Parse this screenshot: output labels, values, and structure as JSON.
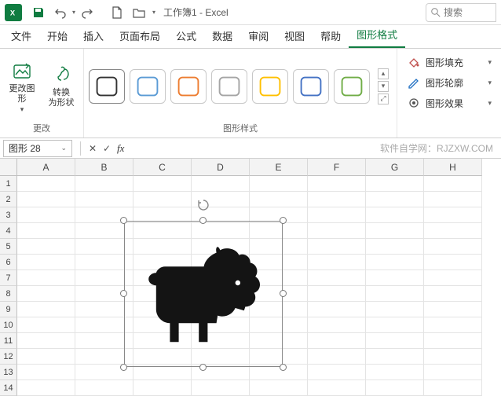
{
  "app": {
    "title": "工作簿1 - Excel"
  },
  "qat": {
    "save": "保存",
    "undo": "撤销",
    "redo": "重做",
    "new": "新建",
    "open": "打开"
  },
  "search": {
    "placeholder": "搜索"
  },
  "tabs": {
    "items": [
      {
        "label": "文件"
      },
      {
        "label": "开始"
      },
      {
        "label": "插入"
      },
      {
        "label": "页面布局"
      },
      {
        "label": "公式"
      },
      {
        "label": "数据"
      },
      {
        "label": "审阅"
      },
      {
        "label": "视图"
      },
      {
        "label": "帮助"
      },
      {
        "label": "图形格式",
        "active": true
      }
    ]
  },
  "ribbon": {
    "group_change": {
      "label": "更改",
      "change_graphic": "更改图\n形",
      "convert_to_shape": "转换\n为形状"
    },
    "group_styles": {
      "label": "图形样式",
      "swatch_colors": [
        "#333333",
        "#5b9bd5",
        "#ed7d31",
        "#a5a5a5",
        "#ffc000",
        "#4472c4",
        "#70ad47"
      ]
    },
    "group_fx": {
      "fill": "图形填充",
      "outline": "图形轮廓",
      "effects": "图形效果"
    }
  },
  "formula_bar": {
    "name_box": "图形 28",
    "fx": "fx",
    "watermark": "软件自学网：RJZXW.COM"
  },
  "grid": {
    "cols": [
      "A",
      "B",
      "C",
      "D",
      "E",
      "F",
      "G",
      "H"
    ],
    "rows": [
      "1",
      "2",
      "3",
      "4",
      "5",
      "6",
      "7",
      "8",
      "9",
      "10",
      "11",
      "12",
      "13",
      "14"
    ]
  },
  "shape": {
    "name": "lion-icon"
  }
}
